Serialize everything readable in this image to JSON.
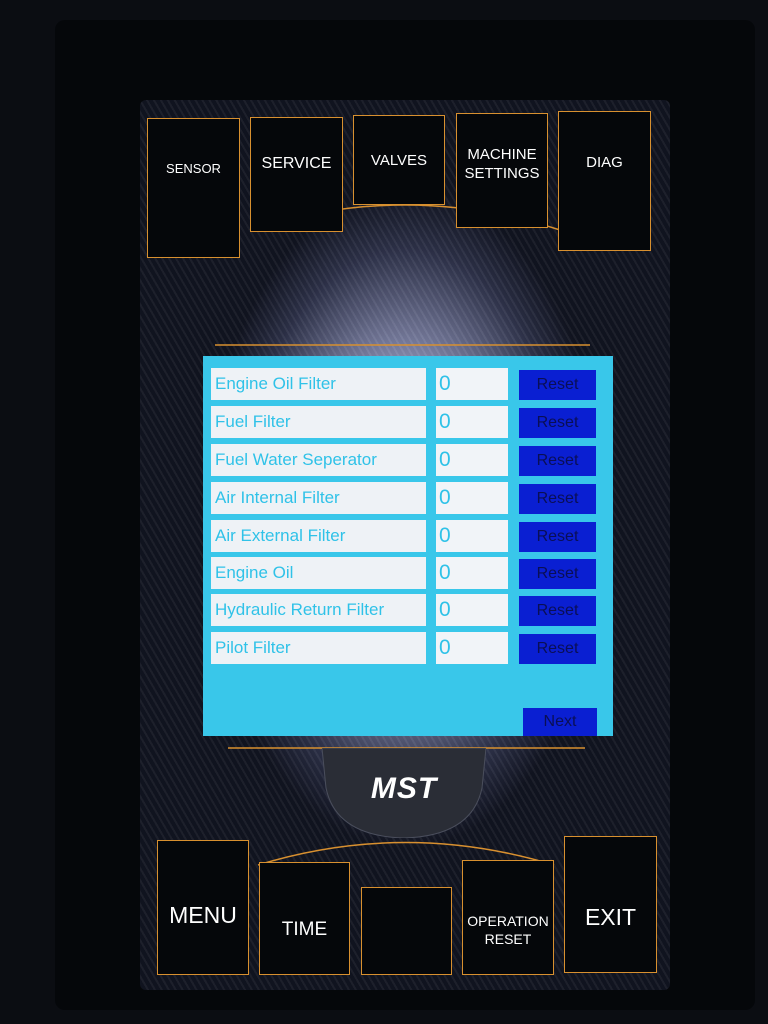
{
  "top_nav": [
    {
      "label": "SENSOR"
    },
    {
      "label": "SERVICE"
    },
    {
      "label": "VALVES"
    },
    {
      "label": "MACHINE\nSETTINGS"
    },
    {
      "label": "DIAG"
    }
  ],
  "service_panel": {
    "items": [
      {
        "name": "Engine Oil Filter",
        "value": "0",
        "reset_label": "Reset"
      },
      {
        "name": "Fuel Filter",
        "value": "0",
        "reset_label": "Reset"
      },
      {
        "name": "Fuel Water Seperator",
        "value": "0",
        "reset_label": "Reset"
      },
      {
        "name": "Air Internal Filter",
        "value": "0",
        "reset_label": "Reset"
      },
      {
        "name": "Air External Filter",
        "value": "0",
        "reset_label": "Reset"
      },
      {
        "name": "Engine Oil",
        "value": "0",
        "reset_label": "Reset"
      },
      {
        "name": "Hydraulic Return Filter",
        "value": "0",
        "reset_label": "Reset"
      },
      {
        "name": "Pilot Filter",
        "value": "0",
        "reset_label": "Reset"
      }
    ],
    "next_label": "Next"
  },
  "logo": {
    "text": "MST"
  },
  "bottom_nav": [
    {
      "label": "MENU"
    },
    {
      "label": "TIME"
    },
    {
      "label": ""
    },
    {
      "label": "OPERATION\nRESET"
    },
    {
      "label": "EXIT"
    }
  ],
  "colors": {
    "accent_orange": "#d8902f",
    "panel_cyan": "#39c7ea",
    "reset_blue": "#0a1fd2",
    "button_black": "#05070a"
  }
}
